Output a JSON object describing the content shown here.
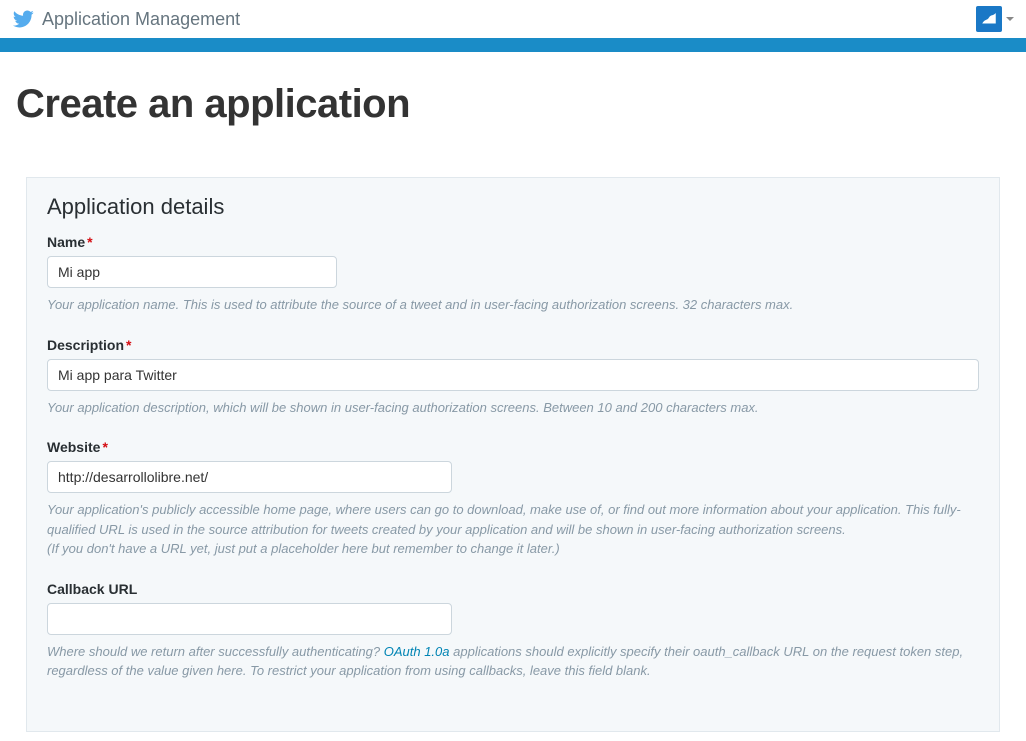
{
  "topbar": {
    "title": "Application Management"
  },
  "page": {
    "title": "Create an application"
  },
  "panel": {
    "heading": "Application details"
  },
  "form": {
    "name": {
      "label": "Name",
      "value": "Mi app",
      "help": "Your application name. This is used to attribute the source of a tweet and in user-facing authorization screens. 32 characters max."
    },
    "description": {
      "label": "Description",
      "value": "Mi app para Twitter",
      "help": "Your application description, which will be shown in user-facing authorization screens. Between 10 and 200 characters max."
    },
    "website": {
      "label": "Website",
      "value": "http://desarrollolibre.net/",
      "help1": "Your application's publicly accessible home page, where users can go to download, make use of, or find out more information about your application. This fully-qualified URL is used in the source attribution for tweets created by your application and will be shown in user-facing authorization screens.",
      "help2": "(If you don't have a URL yet, just put a placeholder here but remember to change it later.)"
    },
    "callback": {
      "label": "Callback URL",
      "value": "",
      "help_before": "Where should we return after successfully authenticating? ",
      "help_link": "OAuth 1.0a",
      "help_after": " applications should explicitly specify their oauth_callback URL on the request token step, regardless of the value given here. To restrict your application from using callbacks, leave this field blank."
    }
  }
}
